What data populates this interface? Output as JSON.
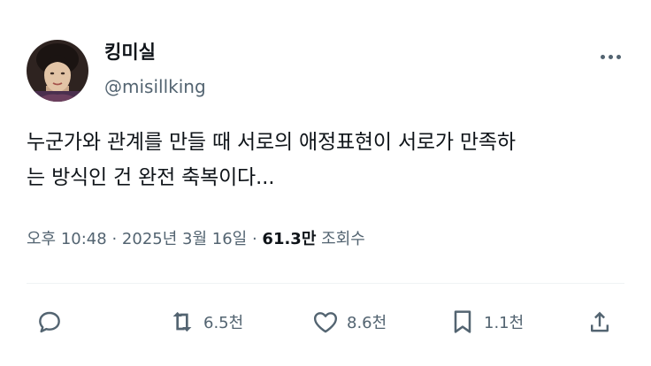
{
  "user": {
    "name": "킹미실",
    "handle": "@misillking"
  },
  "tweet": {
    "text_line1": "누군가와 관계를 만들 때 서로의 애정표현이 서로가 만족하",
    "text_line2": "는 방식인 건 완전 축복이다..."
  },
  "meta": {
    "time": "오후 10:48",
    "separator": "·",
    "date": "2025년 3월 16일",
    "views_count": "61.3만",
    "views_label": "조회수"
  },
  "actions": {
    "retweets": "6.5천",
    "likes": "8.6천",
    "bookmarks": "1.1천"
  },
  "icons": {
    "more": "more-icon",
    "reply": "reply-icon",
    "retweet": "retweet-icon",
    "like": "heart-icon",
    "bookmark": "bookmark-icon",
    "share": "share-icon"
  },
  "colors": {
    "text": "#0f1419",
    "secondary": "#536471",
    "divider": "#eff3f4"
  }
}
